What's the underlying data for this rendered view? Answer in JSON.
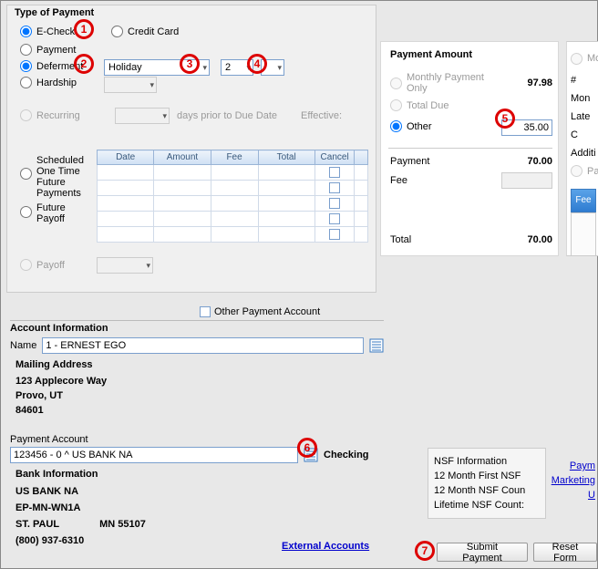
{
  "type_of_payment": {
    "title": "Type of Payment",
    "echeck": "E-Check",
    "creditcard": "Credit Card",
    "payment": "Payment",
    "deferment": "Deferment",
    "hardship": "Hardship",
    "recurring": "Recurring",
    "deferment_reason": "Holiday",
    "deferment_count": "2",
    "days_prior": "days prior to Due Date",
    "effective": "Effective:",
    "sched": "Scheduled One Time Future Payments",
    "future_payoff": "Future\nPayoff",
    "payoff": "Payoff",
    "cols": {
      "date": "Date",
      "amount": "Amount",
      "fee": "Fee",
      "total": "Total",
      "cancel": "Cancel"
    }
  },
  "other_payment_account": "Other Payment Account",
  "payment_amount": {
    "title": "Payment Amount",
    "monthly": "Monthly Payment Only",
    "monthly_val": "97.98",
    "total_due": "Total Due",
    "other": "Other",
    "other_val": "35.00",
    "payment": "Payment",
    "payment_val": "70.00",
    "fee": "Fee",
    "total": "Total",
    "total_val": "70.00",
    "side": {
      "mo": "Mo",
      "num_mo": "# Mon",
      "late": "Late C",
      "addl": "Additi",
      "pay": "Pay",
      "fee": "Fee"
    }
  },
  "account_info": {
    "title": "Account Information",
    "name_label": "Name",
    "name_value": "1 - ERNEST  EGO",
    "mailing": "Mailing Address",
    "addr1": "123 Applecore Way",
    "addr2": "Provo, UT",
    "addr3": "84601",
    "pay_acct_label": "Payment Account",
    "pay_acct_value": "123456 - 0 ^ US BANK NA",
    "acct_type": "Checking",
    "bank_title": "Bank Information",
    "bank_name": "US BANK NA",
    "bank_code": "EP-MN-WN1A",
    "bank_city": "ST. PAUL",
    "bank_state_zip": "MN 55107",
    "bank_phone": "(800) 937-6310",
    "external": "External Accounts"
  },
  "nsf": {
    "title": "NSF Information",
    "first": "12 Month First NSF",
    "count12": "12 Month NSF Coun",
    "lifetime": "Lifetime NSF Count:"
  },
  "links": {
    "paym": "Paym",
    "marketing": "Marketing",
    "u": "U"
  },
  "buttons": {
    "submit": "Submit Payment",
    "reset": "Reset Form"
  }
}
